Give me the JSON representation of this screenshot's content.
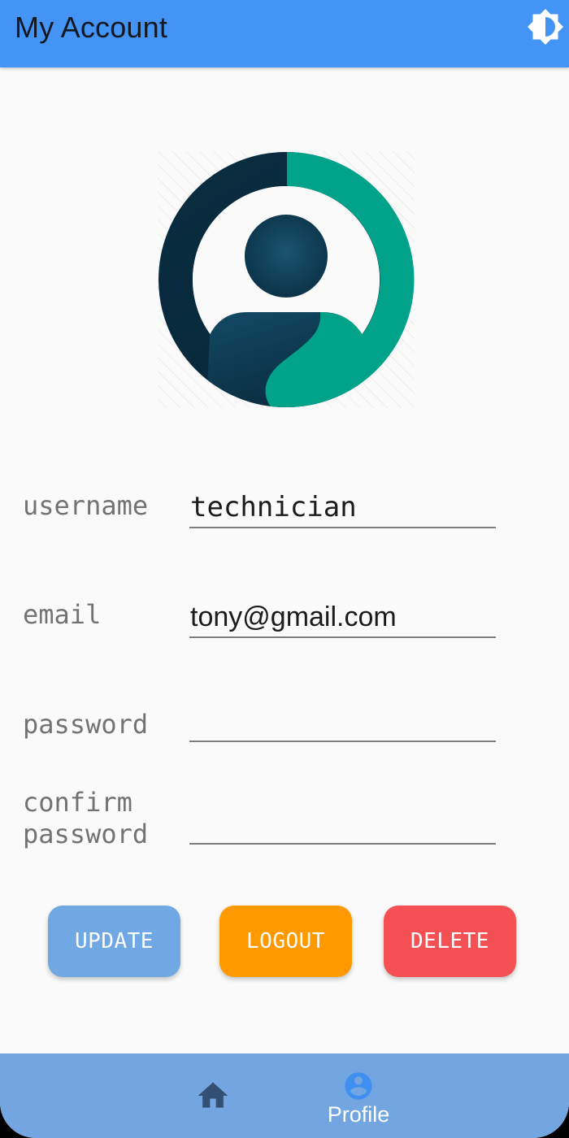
{
  "app_bar": {
    "title": "My Account",
    "theme_icon": "brightness-icon"
  },
  "avatar": {
    "icon": "user-avatar-icon",
    "colors": {
      "dark": "#0d3247",
      "accent": "#00a38a"
    }
  },
  "form": {
    "username": {
      "label": "username",
      "value": "technician"
    },
    "email": {
      "label": "email",
      "value": "tony@gmail.com"
    },
    "password": {
      "label": "password",
      "value": ""
    },
    "confirm_password": {
      "label_line1": "confirm",
      "label_line2": "password",
      "value": ""
    }
  },
  "buttons": {
    "update": {
      "label": "UPDATE",
      "color": "#6fa8e3"
    },
    "logout": {
      "label": "LOGOUT",
      "color": "#ff9900"
    },
    "delete": {
      "label": "DELETE",
      "color": "#f55154"
    }
  },
  "bottom_nav": {
    "items": [
      {
        "icon": "home-icon",
        "label": ""
      },
      {
        "icon": "profile-icon",
        "label": "Profile",
        "active": true
      }
    ]
  }
}
